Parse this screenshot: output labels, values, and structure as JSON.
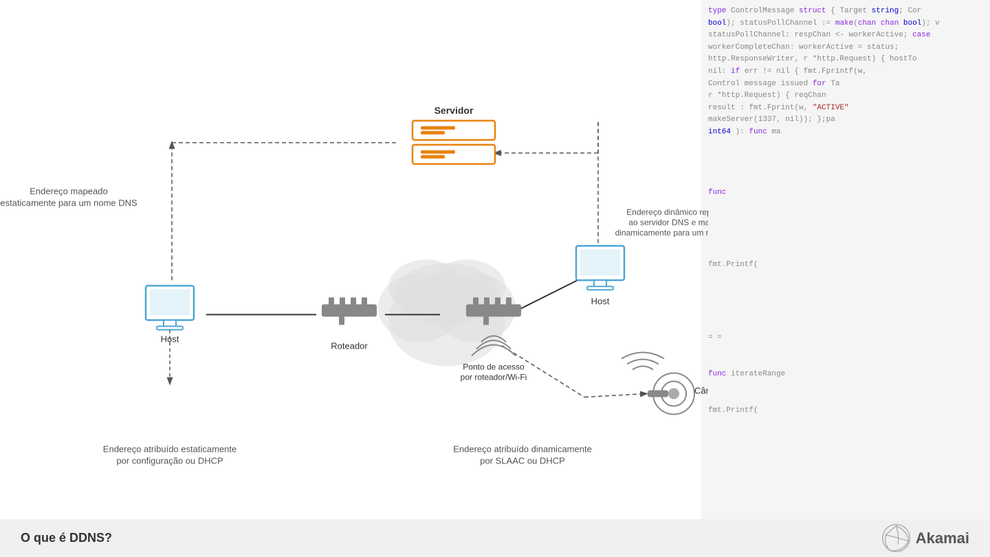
{
  "code": {
    "lines": [
      "type ControlMessage struct { Target string; Cor",
      "bool); statusPollChannel := make(chan chan bool); v",
      "statusPollChannel: respChan <- workerActive; case",
      "workerCompleteChan: workerActive = status;",
      "http.ResponseWriter, r *http.Request) { hostTo",
      "nil: if err != nil { fmt.Fprintf(w,",
      "Control message issued for Ta",
      "r *http.Request) { reqChan",
      "result : fmt.Fprint(w, \"ACTIVE\"",
      "makeServer(1337, nil)); };pa",
      "int64 ): func ma",
      "",
      "",
      "",
      "",
      "func",
      "",
      "",
      "",
      "",
      "",
      "fmt.Printf(",
      "",
      "",
      "",
      "",
      "",
      "= =",
      "",
      "",
      "func iterateRange",
      "",
      "",
      "fmt.Printf(",
      "",
      "",
      "",
      "",
      "",
      ""
    ]
  },
  "labels": {
    "servidor": "Servidor",
    "host_left": "Host",
    "host_right": "Host",
    "roteador": "Roteador",
    "ponto_acesso": "Ponto de acesso\npor roteador/Wi-Fi",
    "camera": "Câmera tipo IP",
    "label_static_dns": "Endereço mapeado\nestaticamento para um nome DNS",
    "label_dynamic_dns": "Endereço dinâmico reportado\nao servidor DNS e mapeado\ndinamicamente para um nome DNS",
    "label_static_addr": "Endereço atribuído estaticamente\npor configuração ou DHCP",
    "label_dynamic_addr": "Endereço atribuído dinamicamente\npor SLAAC ou DHCP",
    "bottom_title": "O que é DDNS?",
    "akamai": "Akamai"
  },
  "colors": {
    "blue": "#4da6d4",
    "orange": "#e8820c",
    "gray": "#888888",
    "dark": "#333333",
    "arrow": "#555555"
  }
}
